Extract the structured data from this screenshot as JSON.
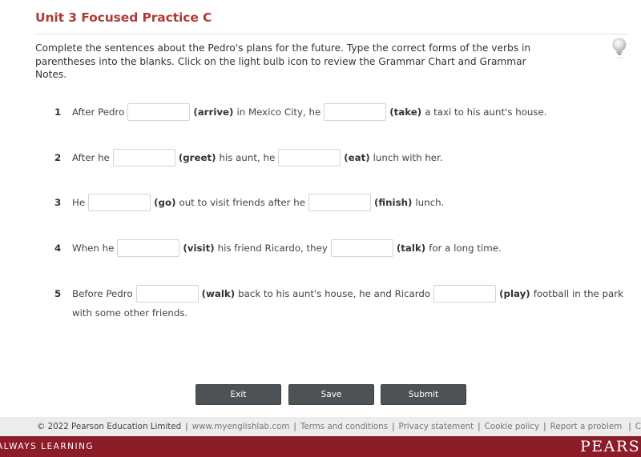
{
  "header": {
    "title": "Unit 3 Focused Practice C",
    "instructions": "Complete the sentences about the Pedro's plans for the future. Type the correct forms of the verbs in parentheses into the blanks. Click on the light bulb icon to review the Grammar Chart and Grammar Notes.",
    "hint_icon": "light-bulb-icon"
  },
  "questions": [
    {
      "number": "1",
      "parts": {
        "a": "After Pedro",
        "v1": "(arrive)",
        "b": "in Mexico City, he",
        "v2": "(take)",
        "c": "a taxi to his aunt's house."
      },
      "blanks": [
        "",
        ""
      ]
    },
    {
      "number": "2",
      "parts": {
        "a": "After he",
        "v1": "(greet)",
        "b": "his aunt, he",
        "v2": "(eat)",
        "c": "lunch with her."
      },
      "blanks": [
        "",
        ""
      ]
    },
    {
      "number": "3",
      "parts": {
        "a": "He",
        "v1": "(go)",
        "b": "out to visit friends after he",
        "v2": "(finish)",
        "c": "lunch."
      },
      "blanks": [
        "",
        ""
      ]
    },
    {
      "number": "4",
      "parts": {
        "a": "When he",
        "v1": "(visit)",
        "b": "his friend Ricardo, they",
        "v2": "(talk)",
        "c": "for a long time."
      },
      "blanks": [
        "",
        ""
      ]
    },
    {
      "number": "5",
      "parts": {
        "a": "Before Pedro",
        "v1": "(walk)",
        "b": "back to his aunt's house, he and Ricardo",
        "v2": "(play)",
        "c": "football in the park",
        "d": "with some other friends."
      },
      "blanks": [
        "",
        ""
      ]
    }
  ],
  "buttons": {
    "exit": "Exit",
    "save": "Save",
    "submit": "Submit"
  },
  "footer": {
    "copyright": "© 2022 Pearson Education Limited",
    "links": [
      "www.myenglishlab.com",
      "Terms and conditions",
      "Privacy statement",
      "Cookie policy",
      "Report a problem",
      "Credits"
    ],
    "separator": "|",
    "tagline": "ALWAYS LEARNING",
    "logo": "PEARSON"
  },
  "colors": {
    "title": "#b03a3a",
    "button": "#4c5255",
    "brand_bar": "#8b1c28",
    "footer_bg": "#ececec"
  }
}
